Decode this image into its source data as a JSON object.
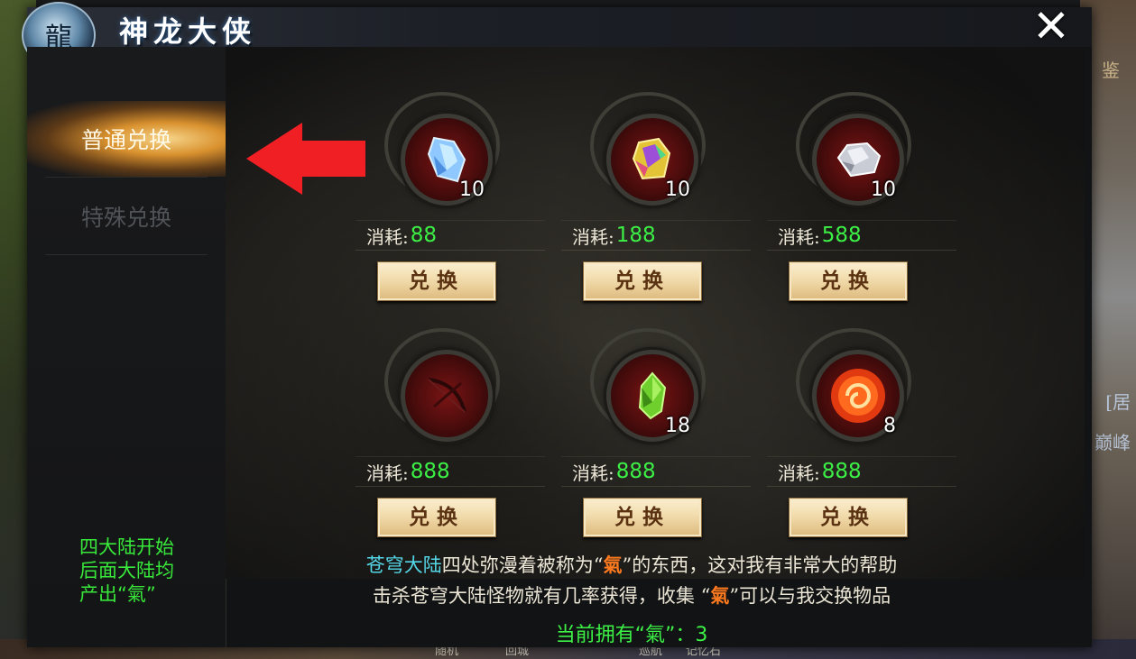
{
  "header": {
    "title": "神龙大侠",
    "emblem_glyph": "龍",
    "close_glyph": "✕"
  },
  "sidebar": {
    "tabs": [
      {
        "label": "普通兑换",
        "active": true
      },
      {
        "label": "特殊兑换",
        "active": false
      }
    ],
    "note_lines": [
      "四大陆开始",
      "后面大陆均",
      "产出“氣”"
    ]
  },
  "items": [
    {
      "icon": "blue-crystal-icon",
      "count": "10",
      "cost_label": "消耗:",
      "cost": "88",
      "button": "兑换"
    },
    {
      "icon": "rainbow-gem-icon",
      "count": "10",
      "cost_label": "消耗:",
      "cost": "188",
      "button": "兑换"
    },
    {
      "icon": "silver-ore-icon",
      "count": "10",
      "cost_label": "消耗:",
      "cost": "588",
      "button": "兑换"
    },
    {
      "icon": "bow-icon",
      "count": "",
      "cost_label": "消耗:",
      "cost": "888",
      "button": "兑换"
    },
    {
      "icon": "green-crystal-icon",
      "count": "18",
      "cost_label": "消耗:",
      "cost": "888",
      "button": "兑换"
    },
    {
      "icon": "fire-orb-icon",
      "count": "8",
      "cost_label": "消耗:",
      "cost": "888",
      "button": "兑换"
    }
  ],
  "description": {
    "line1_part1": "苍穹大陆",
    "line1_part2": "四处弥漫着被称为“",
    "line1_qi": "氣",
    "line1_part3": "”的东西，这对我有非常大的帮助",
    "line2_part1": "击杀苍穹大陆怪物就有几率获得，收集 “",
    "line2_qi": "氣",
    "line2_part2": "”可以与我交换物品"
  },
  "owned": "当前拥有“氣”：3",
  "scene": {
    "side_text_top": "鉴",
    "side_text_mid": "[居",
    "side_text_low": "巅峰",
    "bottom_texts": [
      "随机",
      "回城",
      "巡航",
      "记忆石"
    ]
  },
  "colors": {
    "accent_green": "#3cf046",
    "accent_orange": "#ff7a1e",
    "accent_blue": "#55d6e6",
    "arrow_red": "#ef1f24"
  }
}
